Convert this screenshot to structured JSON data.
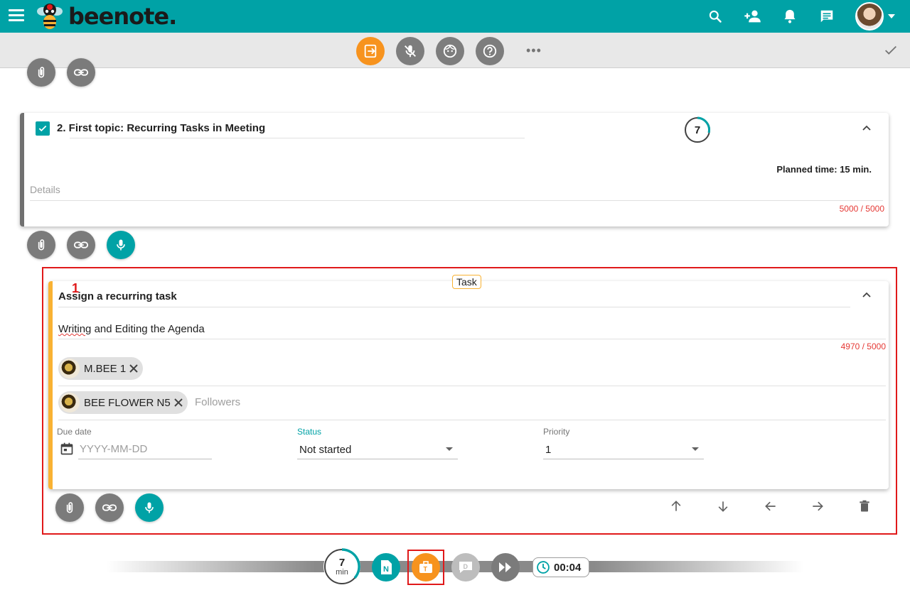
{
  "header": {
    "logo_text": "beenote."
  },
  "toolbar": {
    "more": "•••"
  },
  "topic": {
    "title": "2. First topic: Recurring Tasks in Meeting",
    "timer": "7",
    "planned": "Planned time: 15 min.",
    "details_placeholder": "Details",
    "counter": "5000 / 5000"
  },
  "task": {
    "tag": "Task",
    "annotation": "1",
    "title": "Assign a recurring task",
    "desc_spell": "Writing",
    "desc_rest": " and Editing the Agenda",
    "counter": "4970 / 5000",
    "assignee": "M.BEE 1",
    "follower": "BEE FLOWER N5",
    "followers_placeholder": "Followers",
    "due_label": "Due date",
    "due_placeholder": "YYYY-MM-DD",
    "status_label": "Status",
    "status_value": "Not started",
    "priority_label": "Priority",
    "priority_value": "1"
  },
  "bottom": {
    "timer_value": "7",
    "timer_unit": "min",
    "clock": "00:04"
  },
  "colors": {
    "teal": "#00a2a6",
    "orange": "#f7931e",
    "task_border": "#f9b233",
    "highlight": "#e0191a",
    "counter": "#e53935"
  }
}
